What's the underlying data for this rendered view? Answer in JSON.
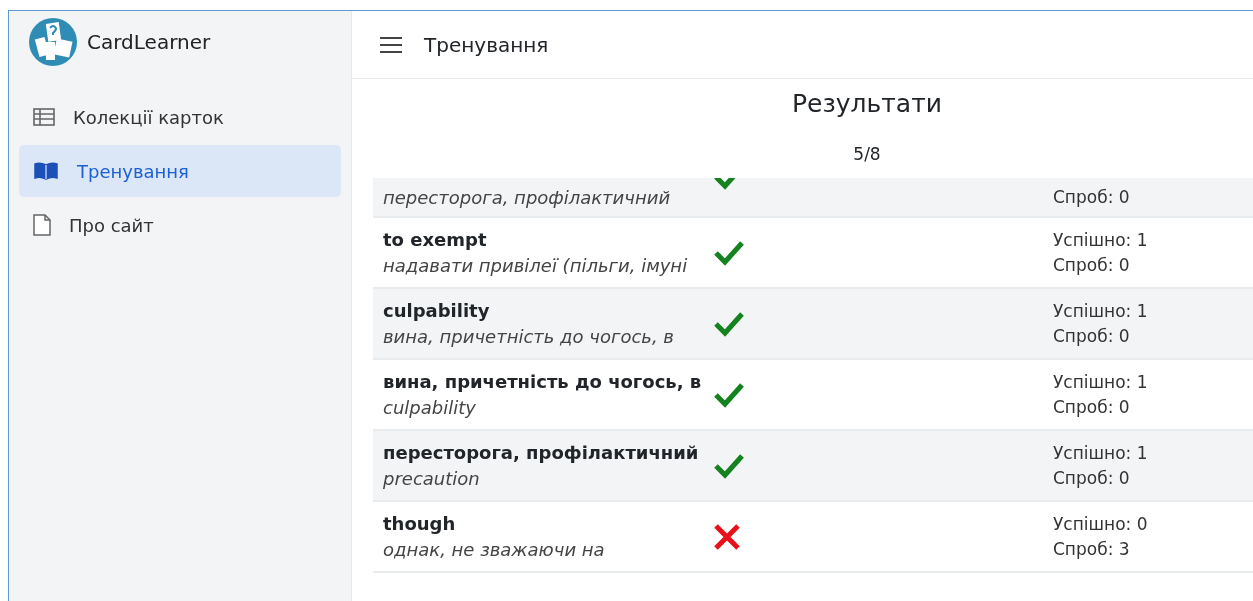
{
  "app": {
    "name": "CardLearner"
  },
  "sidebar": {
    "items": [
      {
        "label": "Колекції карток",
        "kind": "table",
        "selected": false
      },
      {
        "label": "Тренування",
        "kind": "book",
        "selected": true
      },
      {
        "label": "Про сайт",
        "kind": "file",
        "selected": false
      }
    ]
  },
  "header": {
    "title": "Тренування"
  },
  "results": {
    "title": "Результати",
    "score": "5/8",
    "rows": [
      {
        "meaning": "пересторога, профілактичний",
        "correct": true,
        "stats": [
          "Спроб: 0"
        ]
      },
      {
        "term": "to exempt",
        "meaning": "надавати привілеї (пільги, імуні",
        "correct": true,
        "stats": [
          "Успішно: 1",
          "Спроб: 0"
        ]
      },
      {
        "term": "culpability",
        "meaning": "вина, причетність до чогось, в",
        "correct": true,
        "stats": [
          "Успішно: 1",
          "Спроб: 0"
        ]
      },
      {
        "term": "вина, причетність до чогось, в",
        "meaning": "culpability",
        "correct": true,
        "stats": [
          "Успішно: 1",
          "Спроб: 0"
        ]
      },
      {
        "term": "пересторога, профілактичний",
        "meaning": "precaution",
        "correct": true,
        "stats": [
          "Успішно: 1",
          "Спроб: 0"
        ]
      },
      {
        "term": "though",
        "meaning": "однак, не зважаючи на",
        "correct": false,
        "stats": [
          "Успішно: 0",
          "Спроб: 3"
        ]
      }
    ]
  }
}
